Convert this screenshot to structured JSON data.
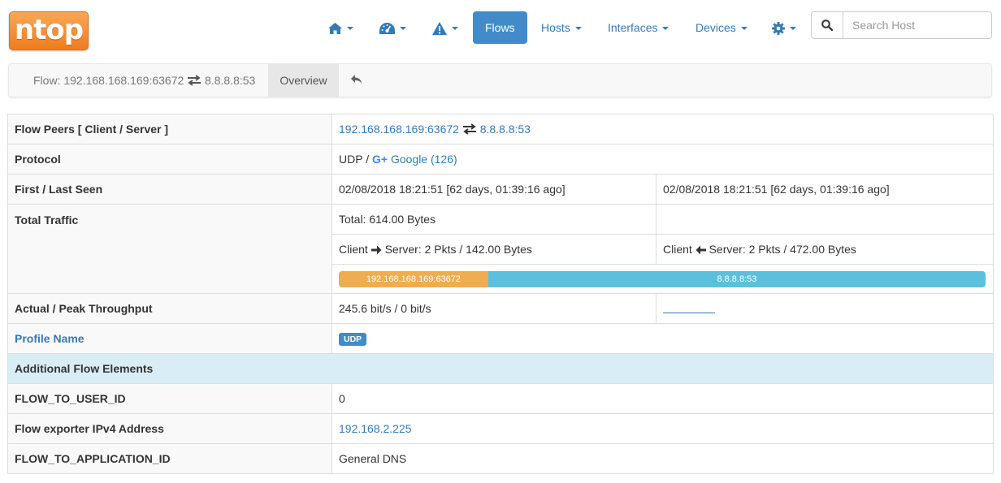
{
  "logo": {
    "text": "ntop"
  },
  "nav": {
    "home_icon": "home-icon",
    "dashboard_icon": "dashboard-icon",
    "alerts_icon": "warning-icon",
    "flows": "Flows",
    "hosts": "Hosts",
    "interfaces": "Interfaces",
    "devices": "Devices",
    "settings_icon": "gear-icon"
  },
  "search": {
    "placeholder": "Search Host",
    "icon": "search-icon"
  },
  "breadcrumb": {
    "prefix": "Flow: 192.168.168.169:63672",
    "server": "8.8.8.8:53",
    "tab_overview": "Overview",
    "back_icon": "reply-icon"
  },
  "table": {
    "flow_peers": {
      "label": "Flow Peers [ Client / Server ]",
      "client": "192.168.168.169:63672",
      "server": "8.8.8.8:53"
    },
    "protocol": {
      "label": "Protocol",
      "l4": "UDP /",
      "app_icon": "google-plus-icon",
      "app": "Google (126)"
    },
    "seen": {
      "label": "First / Last Seen",
      "first": "02/08/2018 18:21:51 [62 days, 01:39:16 ago]",
      "last": "02/08/2018 18:21:51 [62 days, 01:39:16 ago]"
    },
    "traffic": {
      "label": "Total Traffic",
      "total": "Total: 614.00 Bytes",
      "cli2srv_prefix": "Client",
      "cli2srv_suffix": "Server: 2 Pkts / 142.00 Bytes",
      "srv2cli_prefix": "Client",
      "srv2cli_suffix": "Server: 2 Pkts / 472.00 Bytes",
      "bar_client_label": "192.168.168.169:63672",
      "bar_server_label": "8.8.8.8:53",
      "bar_client_fraction": 0.231,
      "client_color": "#f0ad4e",
      "server_color": "#5bc0de"
    },
    "throughput": {
      "label": "Actual / Peak Throughput",
      "value": "245.6 bit/s / 0 bit/s"
    },
    "profile": {
      "label": "Profile Name",
      "badge": "UDP"
    },
    "additional": {
      "label": "Additional Flow Elements"
    },
    "flow_to_user": {
      "label": "FLOW_TO_USER_ID",
      "value": "0"
    },
    "exporter": {
      "label": "Flow exporter IPv4 Address",
      "value": "192.168.2.225"
    },
    "flow_to_app": {
      "label": "FLOW_TO_APPLICATION_ID",
      "value": "General DNS"
    }
  }
}
